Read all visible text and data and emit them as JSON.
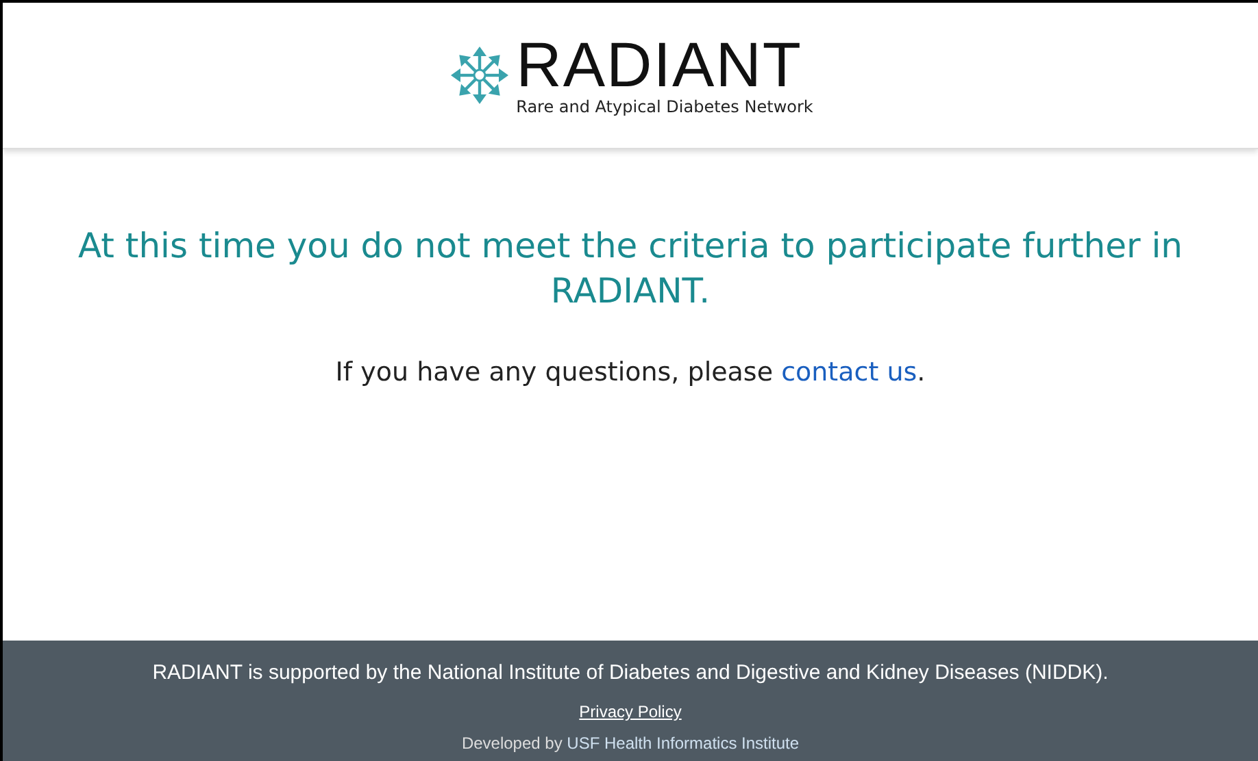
{
  "header": {
    "logo_text": "RADIANT",
    "tagline": "Rare and Atypical Diabetes Network"
  },
  "message": {
    "heading": "At this time you do not meet the criteria to participate further in RADIANT.",
    "body_prefix": "If you have any questions, please",
    "link": "contact us",
    "body_suffix": "."
  },
  "footer": {
    "support": "RADIANT is supported by the National Institute of Diabetes and Digestive and Kidney Diseases (NIDDK).",
    "privacy_link": "Privacy Policy",
    "developed_prefix": "Developed by",
    "developed_link": "USF Health Informatics Institute"
  }
}
